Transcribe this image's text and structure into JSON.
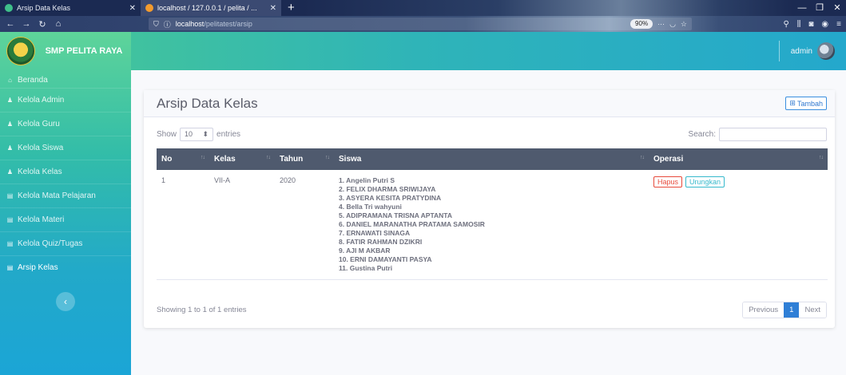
{
  "browser": {
    "tabs": [
      {
        "title": "Arsip Data Kelas",
        "active": false
      },
      {
        "title": "localhost / 127.0.0.1 / pelita / ...",
        "active": true
      }
    ],
    "new_tab": "+",
    "url_host": "localhost",
    "url_path": "/pelitatest/arsip",
    "zoom": "90%"
  },
  "app": {
    "brand": "SMP PELITA RAYA",
    "user": "admin"
  },
  "sidebar": {
    "items": [
      {
        "label": "Beranda",
        "icon": "house-icon"
      },
      {
        "label": "Kelola Admin",
        "icon": "user-icon"
      },
      {
        "label": "Kelola Guru",
        "icon": "user-icon"
      },
      {
        "label": "Kelola Siswa",
        "icon": "users-icon"
      },
      {
        "label": "Kelola Kelas",
        "icon": "user-icon"
      },
      {
        "label": "Kelola Mata Pelajaran",
        "icon": "list-icon"
      },
      {
        "label": "Kelola Materi",
        "icon": "list-icon"
      },
      {
        "label": "Kelola Quiz/Tugas",
        "icon": "list-icon"
      },
      {
        "label": "Arsip Kelas",
        "icon": "list-icon"
      }
    ],
    "toggle": "‹"
  },
  "page": {
    "title": "Arsip Data Kelas",
    "add_label": "Tambah"
  },
  "table": {
    "show_label": "Show",
    "length_value": "10",
    "entries_label": "entries",
    "search_label": "Search:",
    "columns": [
      "No",
      "Kelas",
      "Tahun",
      "Siswa",
      "Operasi"
    ],
    "rows": [
      {
        "no": "1",
        "kelas": "VII-A",
        "tahun": "2020",
        "siswa": [
          "1. Angelin Putri S",
          "2. FELIX DHARMA SRIWIJAYA",
          "3. ASYERA KESITA PRATYDINA",
          "4. Bella Tri wahyuni",
          "5. ADIPRAMANA TRISNA APTANTA",
          "6. DANIEL MARANATHA PRATAMA SAMOSIR",
          "7. ERNAWATI SINAGA",
          "8. FATIR RAHMAN DZIKRI",
          "9. AJI M AKBAR",
          "10. ERNI DAMAYANTI PASYA",
          "11. Gustina Putri"
        ],
        "hapus": "Hapus",
        "urungkan": "Urungkan"
      }
    ],
    "info": "Showing 1 to 1 of 1 entries",
    "pager": {
      "prev": "Previous",
      "current": "1",
      "next": "Next"
    }
  }
}
